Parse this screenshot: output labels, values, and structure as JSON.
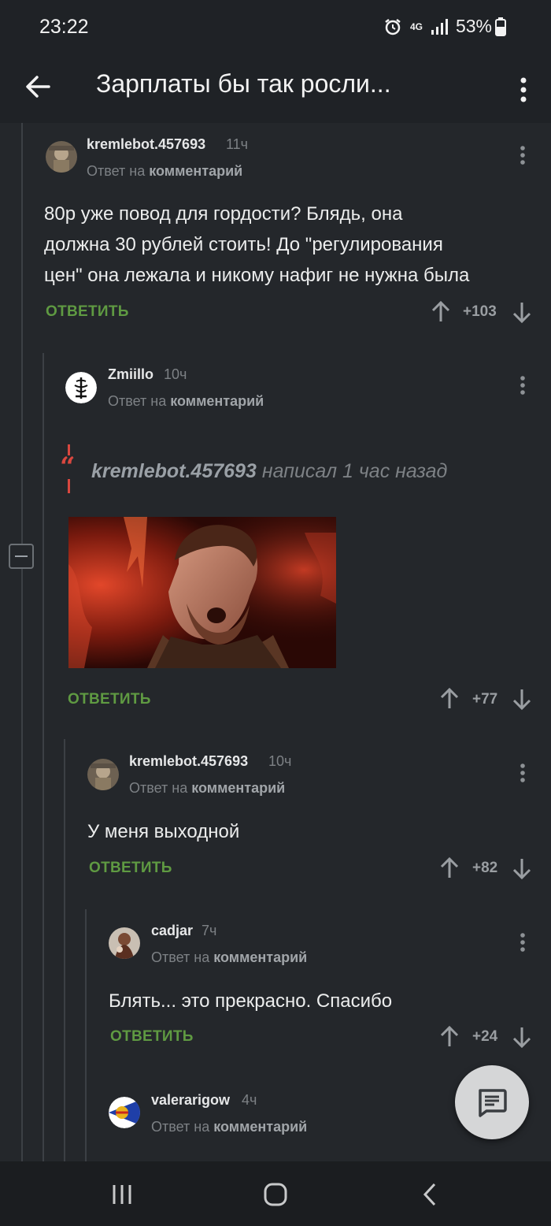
{
  "status": {
    "time": "23:22",
    "network": "4G",
    "battery": "53%",
    "alarm_icon": "alarm-icon",
    "signal_icon": "signal-icon",
    "battery_icon": "battery-icon"
  },
  "header": {
    "title": "Зарплаты бы так росли...",
    "back_icon": "arrow-left-icon",
    "menu_icon": "more-vert-icon"
  },
  "comments": [
    {
      "username": "kremlebot.457693",
      "time": "11ч",
      "reply_prefix": "Ответ на",
      "reply_target": "комментарий",
      "lines": [
        "80р уже повод для гордости? Блядь, она",
        "должна 30 рублей стоить! До \"регулирования",
        "цен\" она лежала и никому нафиг не нужна была"
      ],
      "reply_label": "ОТВЕТИТЬ",
      "score": "+103"
    },
    {
      "username": "Zmiillo",
      "time": "10ч",
      "reply_prefix": "Ответ на",
      "reply_target": "комментарий",
      "quote_author": "kremlebot.457693",
      "quote_suffix": "написал 1 час назад",
      "reply_label": "ОТВЕТИТЬ",
      "score": "+77"
    },
    {
      "username": "kremlebot.457693",
      "time": "10ч",
      "reply_prefix": "Ответ на",
      "reply_target": "комментарий",
      "lines": [
        "У меня выходной"
      ],
      "reply_label": "ОТВЕТИТЬ",
      "score": "+82"
    },
    {
      "username": "cadjar",
      "time": "7ч",
      "reply_prefix": "Ответ на",
      "reply_target": "комментарий",
      "lines": [
        "Блять... это прекрасно. Спасибо"
      ],
      "reply_label": "ОТВЕТИТЬ",
      "score": "+24"
    },
    {
      "username": "valerarigow",
      "time": "4ч",
      "reply_prefix": "Ответ на",
      "reply_target": "комментарий"
    }
  ],
  "fab_icon": "comment-icon",
  "nav": {
    "recents_icon": "recents-icon",
    "home_icon": "home-icon",
    "back_icon": "nav-back-icon"
  },
  "colors": {
    "background": "#24272b",
    "reply_green": "#5f9a42",
    "quote_red": "#d9473f"
  }
}
